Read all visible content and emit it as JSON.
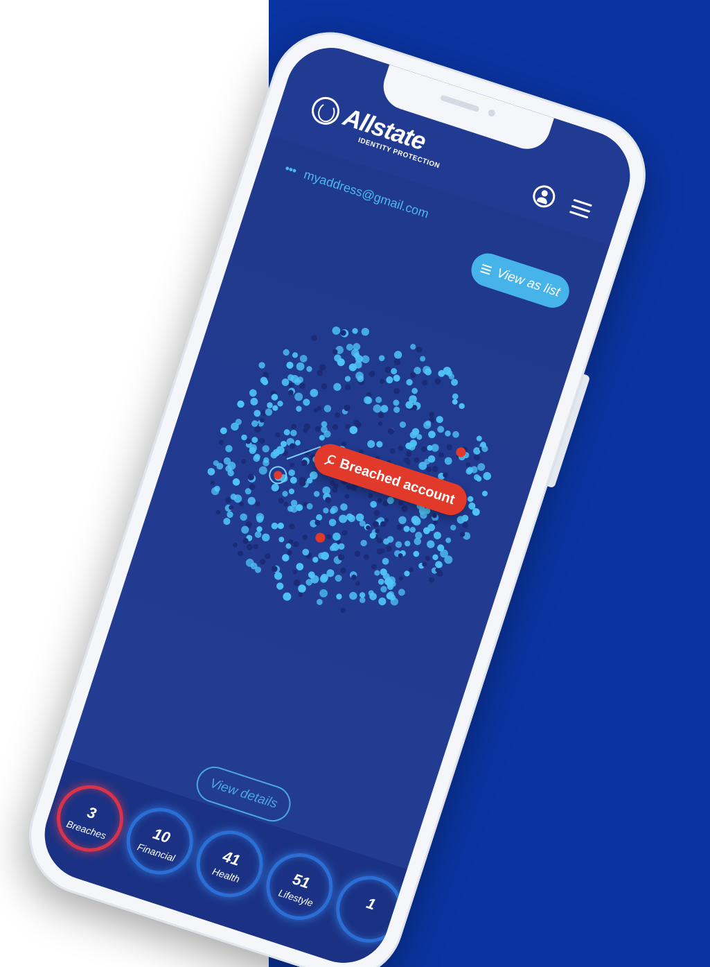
{
  "brand": {
    "name": "Allstate",
    "subtitle": "IDENTITY PROTECTION"
  },
  "account": {
    "dots": "•••",
    "email": "myaddress@gmail.com"
  },
  "actions": {
    "view_as_list": "View as list",
    "view_details": "View details"
  },
  "alert": {
    "label": "Breached account"
  },
  "stats": [
    {
      "value": "3",
      "label": "Breaches"
    },
    {
      "value": "10",
      "label": "Financial"
    },
    {
      "value": "41",
      "label": "Health"
    },
    {
      "value": "51",
      "label": "Lifestyle"
    },
    {
      "value": "1",
      "label": ""
    }
  ],
  "colors": {
    "background": "#0a34a0",
    "screen": "#213a8f",
    "accent": "#46b4e8",
    "alert": "#e23a2a",
    "node": "#4fc3f7",
    "node_dim": "#1a2c78"
  },
  "icons": {
    "logo": "allstate-hands-logo",
    "user": "user-icon",
    "menu": "hamburger-menu-icon",
    "list": "list-icon",
    "wrench": "wrench-icon"
  }
}
